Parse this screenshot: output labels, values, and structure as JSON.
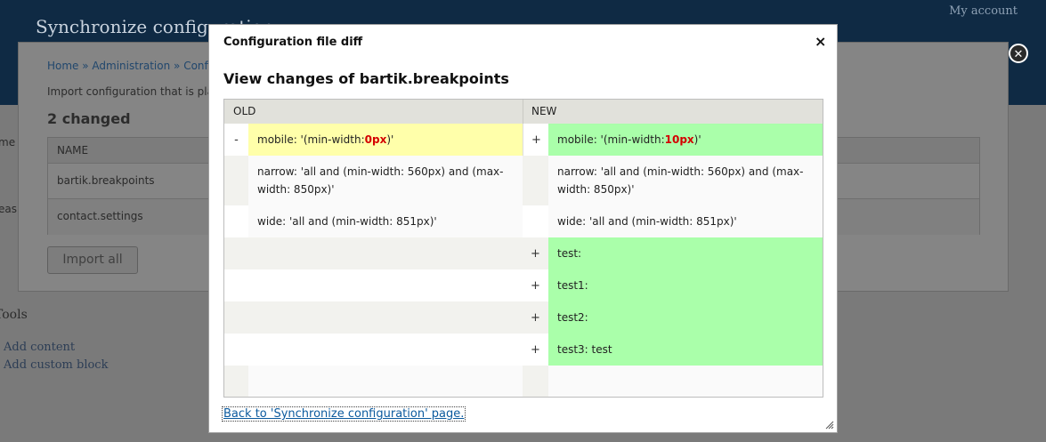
{
  "background": {
    "page_title": "Synchronize configuration",
    "account_link": "My account",
    "breadcrumb": "Home » Administration » Configu",
    "description": "Import configuration that is pla",
    "changed_count": "2 changed",
    "table_header": "NAME",
    "rows": [
      "bartik.breakpoints",
      "contact.settings"
    ],
    "import_button": "Import all",
    "tools_heading": "Tools",
    "tools_links": [
      "Add content",
      "Add custom block"
    ],
    "clipped_left": [
      "me",
      "eas"
    ]
  },
  "dialog": {
    "title": "Configuration file diff",
    "close_label": "×",
    "heading": "View changes of bartik.breakpoints",
    "col_old": "OLD",
    "col_new": "NEW",
    "back_link": "Back to 'Synchronize configuration' page."
  },
  "diff": {
    "rows": [
      {
        "old_mark": "-",
        "old_pre": "mobile: '(min-width: ",
        "old_hl": "0px",
        "old_post": ")'",
        "new_mark": "+",
        "new_pre": "mobile: '(min-width: ",
        "new_hl": "10px",
        "new_post": ")'"
      },
      {
        "old_text": "narrow: 'all and (min-width: 560px) and (max-width: 850px)'",
        "new_text": "narrow: 'all and (min-width: 560px) and (max-width: 850px)'"
      },
      {
        "old_text": "wide: 'all and (min-width: 851px)'",
        "new_text": "wide: 'all and (min-width: 851px)'"
      },
      {
        "new_mark": "+",
        "new_text": "test:"
      },
      {
        "new_mark": "+",
        "new_text": "test1:"
      },
      {
        "new_mark": "+",
        "new_text": "test2:"
      },
      {
        "new_mark": "+",
        "new_text": "test3: test"
      }
    ]
  },
  "colors": {
    "deleted": "#ffffaa",
    "added": "#aaffaa",
    "highlight": "#d40000",
    "context_alt": "#f2f2ee"
  }
}
